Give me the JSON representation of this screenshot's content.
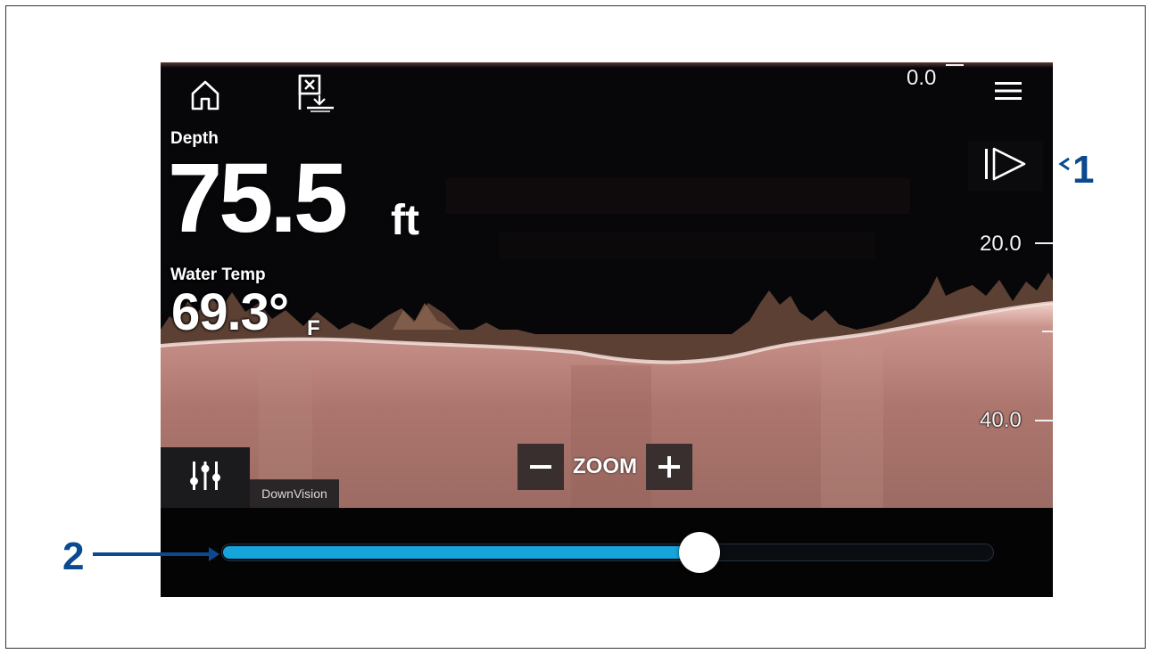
{
  "toolbar": {
    "home_icon": "home-icon",
    "mob_icon": "man-overboard-flag-icon",
    "menu_icon": "hamburger-menu-icon",
    "play_icon": "play-resume-icon"
  },
  "depth_scale": {
    "labels": [
      "0.0",
      "20.0",
      "40.0"
    ]
  },
  "readouts": {
    "depth_label": "Depth",
    "depth_value": "75.5",
    "depth_unit": "ft",
    "temp_label": "Water Temp",
    "temp_value": "69.3°",
    "temp_unit": "F"
  },
  "zoom": {
    "minus": "−",
    "label": "ZOOM",
    "plus": "+"
  },
  "settings": {
    "icon": "sliders-settings-icon",
    "source_label": "DownVision"
  },
  "history": {
    "position_fraction": 0.62
  },
  "callouts": {
    "one": "1",
    "two": "2"
  },
  "colors": {
    "accent": "#17a4db",
    "callout": "#0c4a90",
    "sonar_bottom": "#b87f77"
  }
}
